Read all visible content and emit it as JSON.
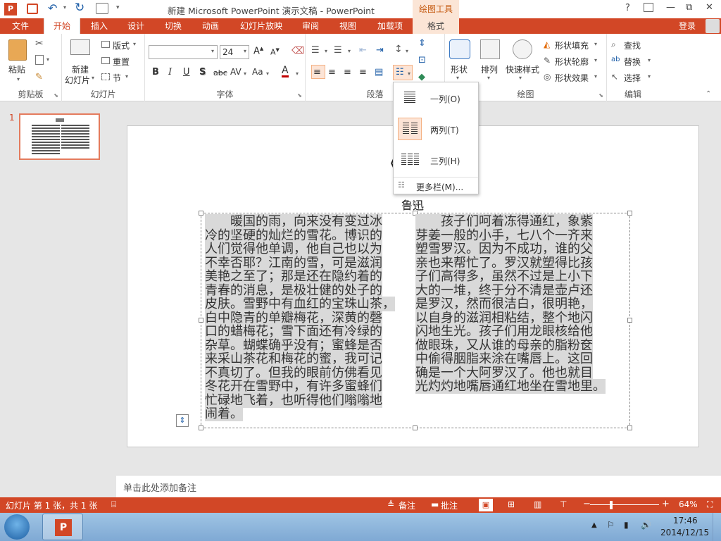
{
  "window": {
    "title": "新建 Microsoft PowerPoint 演示文稿 - PowerPoint",
    "help": "?",
    "min": "—",
    "max": "□",
    "close": "✕",
    "restore": "⧉"
  },
  "context": {
    "header": "绘图工具",
    "tab": "格式"
  },
  "tabs": [
    "文件",
    "开始",
    "插入",
    "设计",
    "切换",
    "动画",
    "幻灯片放映",
    "审阅",
    "视图",
    "加载项"
  ],
  "signin": "登录",
  "ribbon": {
    "clipboard": {
      "label": "剪贴板",
      "paste": "粘贴"
    },
    "slides": {
      "label": "幻灯片",
      "new_slide_1": "新建",
      "new_slide_2": "幻灯片",
      "layout": "版式",
      "reset": "重置",
      "section": "节"
    },
    "font": {
      "label": "字体",
      "font_name": "",
      "font_size": "24",
      "bold": "B",
      "italic": "I",
      "underline": "U",
      "shadow": "S",
      "strike": "abc",
      "spacing": "AV",
      "case": "Aa",
      "color": "A"
    },
    "paragraph": {
      "label": "段落"
    },
    "drawing": {
      "label": "绘图",
      "shapes": "形状",
      "arrange": "排列",
      "quick_styles": "快速样式",
      "fill": "形状填充",
      "outline": "形状轮廓",
      "effects": "形状效果"
    },
    "editing": {
      "label": "编辑",
      "find": "查找",
      "replace": "替换",
      "select": "选择"
    }
  },
  "dropdown": {
    "one": "一列(O)",
    "two": "两列(T)",
    "three": "三列(H)",
    "more": "更多栏(M)..."
  },
  "thumbnail": {
    "number": "1"
  },
  "slide": {
    "title": "《",
    "author": "鲁迅",
    "col1": [
      "　　暖国的雨，向来没有变过冰",
      "冷的坚硬的灿烂的雪花。博识的",
      "人们觉得他单调，他自己也以为",
      "不幸否耶？江南的雪，可是滋润",
      "美艳之至了；那是还在隐约着的",
      "青春的消息，是极壮健的处子的",
      "皮肤。雪野中有血红的宝珠山茶，",
      "白中隐青的单瓣梅花，深黄的磬",
      "口的蜡梅花；雪下面还有冷绿的",
      "杂草。蝴蝶确乎没有；蜜蜂是否",
      "来采山茶花和梅花的蜜，我可记",
      "不真切了。但我的眼前仿佛看见",
      "冬花开在雪野中，有许多蜜蜂们",
      "忙碌地飞着，也听得他们嗡嗡地",
      "闹着。"
    ],
    "col2": [
      "　　孩子们呵着冻得通红，象紫",
      "芽姜一般的小手，七八个一齐来",
      "塑雪罗汉。因为不成功，谁的父",
      "亲也来帮忙了。罗汉就塑得比孩",
      "子们高得多，虽然不过是上小下",
      "大的一堆，终于分不清是壶卢还",
      "是罗汉，然而很洁白，很明艳，",
      "以自身的滋润相粘结，整个地闪",
      "闪地生光。孩子们用龙眼核给他",
      "做眼珠，又从谁的母亲的脂粉奁",
      "中偷得胭脂来涂在嘴唇上。这回",
      "确是一个大阿罗汉了。他也就目",
      "光灼灼地嘴唇通红地坐在雪地里。"
    ]
  },
  "notes": {
    "placeholder": "单击此处添加备注"
  },
  "status": {
    "slide_info": "幻灯片 第 1 张，共 1 张",
    "notes": "备注",
    "comments": "批注",
    "zoom": "64%"
  },
  "taskbar": {
    "time": "17:46",
    "date": "2014/12/15"
  }
}
